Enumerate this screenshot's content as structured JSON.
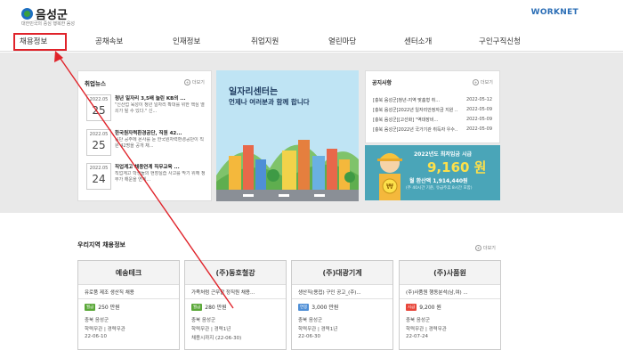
{
  "header": {
    "logo_text": "음성군",
    "logo_sub": "대한민국의 중심 행복한 음성",
    "partner_logo": "WORKNET"
  },
  "nav": {
    "items": [
      "채용정보",
      "공채속보",
      "인재정보",
      "취업지원",
      "열린마당",
      "센터소개",
      "구인구직신청"
    ],
    "active_index": 0
  },
  "news": {
    "title": "취업뉴스",
    "more": "더보기",
    "items": [
      {
        "ym": "2022.05",
        "day": "25",
        "title": "청년 일자리 3,5배 늘린 KB의 ...",
        "desc": "\"신산업 육성이 청년 일자리 확대를 위한 핵심 열쇠가 될 수 있다.\" 신..."
      },
      {
        "ym": "2022.05",
        "day": "25",
        "title": "한국원자력환경공단, 직원 42...",
        "desc": "공단 공주에 몬사를 둔 한국원자력환경공단이 직원 42명을 공개 채..."
      },
      {
        "ym": "2022.05",
        "day": "24",
        "title": "직업계고 채용연계 직무교육 ...",
        "desc": "직업계고 학생들의 현장실습 사고를 막기 위해 정부가 해운을 연계..."
      }
    ]
  },
  "banner": {
    "line1": "일자리센터는",
    "line2": "언제나 여러분과 함께 합니다"
  },
  "notice": {
    "title": "공지사항",
    "more": "더보기",
    "items": [
      {
        "text": "[충북 음성군]청년-지역 맞춤형 취...",
        "date": "2022-05-12"
      },
      {
        "text": "[충북 음성군]2022년 일자리안정자금 지원 ...",
        "date": "2022-05-09"
      },
      {
        "text": "[충북 음성군][고선화] \"역대장비...",
        "date": "2022-05-09"
      },
      {
        "text": "[충북 음성군]2022년 국가기관 취득자 우수...",
        "date": "2022-05-09"
      }
    ]
  },
  "wage": {
    "line1": "2022년도 최저임금 시급",
    "amount": "9,160 원",
    "monthly": "월 환산액 1,914,440원",
    "note": "(주 40시간 기준, 유급주휴 8시간 포함)"
  },
  "jobs_section": {
    "title": "우리지역 채용정보",
    "more": "더보기",
    "items": [
      {
        "company": "예송테크",
        "title": "유로품 제조 생산직 채용",
        "badge": "월급",
        "badge_color": "#5aa838",
        "pay": "250 만원",
        "region": "충북 음성군",
        "req": "학력무관 | 경력무관",
        "deadline": "22-06-10"
      },
      {
        "company": "(주)동호철강",
        "title": "가족처럼 근무할 정직원 채용...",
        "badge": "월급",
        "badge_color": "#5aa838",
        "pay": "280 만원",
        "region": "충북 음성군",
        "req": "학력무관 | 경력1년",
        "deadline": "채용시까지 (22-06-30)"
      },
      {
        "company": "(주)대광기계",
        "title": "생산직(용접) 구인 공고_(주)...",
        "badge": "연봉",
        "badge_color": "#4f8fd6",
        "pay": "3,000 만원",
        "region": "충북 음성군",
        "req": "학력무관 | 경력1년",
        "deadline": "22-06-30"
      },
      {
        "company": "(주)사품원",
        "title": "(주)사품원 행동분석(남,여) ...",
        "badge": "시급",
        "badge_color": "#e8463a",
        "pay": "9,200 원",
        "region": "충북 음성군",
        "req": "학력무관 | 경력무관",
        "deadline": "22-07-24"
      }
    ]
  }
}
